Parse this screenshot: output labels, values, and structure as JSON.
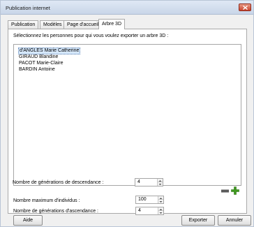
{
  "window": {
    "title": "Publication internet"
  },
  "tabs": [
    {
      "label": "Publication",
      "active": false
    },
    {
      "label": "Modèles",
      "active": false
    },
    {
      "label": "Page d'accueil",
      "active": false
    },
    {
      "label": "Arbre 3D",
      "active": true
    }
  ],
  "panel": {
    "instruction": "Sélectionnez les personnes pour qui vous voulez exporter un arbre 3D :",
    "persons": [
      {
        "name": "d'ANGLES Marie Catherine",
        "selected": true
      },
      {
        "name": "GIRAUD Blandine",
        "selected": false
      },
      {
        "name": "PACOT Marie-Claire",
        "selected": false
      },
      {
        "name": "BARDIN Antoine",
        "selected": false
      }
    ],
    "fields": {
      "max_individuals": {
        "label": "Nombre maximum d'individus :",
        "value": "100"
      },
      "ascendance_generations": {
        "label": "Nombre de générations d'ascendance :",
        "value": "4"
      },
      "descendance_generations": {
        "label": "Nombre de générations de descendance :",
        "value": "4"
      }
    }
  },
  "buttons": {
    "help": "Aide",
    "export": "Exporter",
    "cancel": "Annuler"
  },
  "icons": {
    "remove": "minus-icon",
    "add": "plus-icon"
  },
  "colors": {
    "close": "#c9432d",
    "add": "#3f9a1f",
    "remove": "#5a5a5a",
    "selection": "#d6e8fb"
  }
}
